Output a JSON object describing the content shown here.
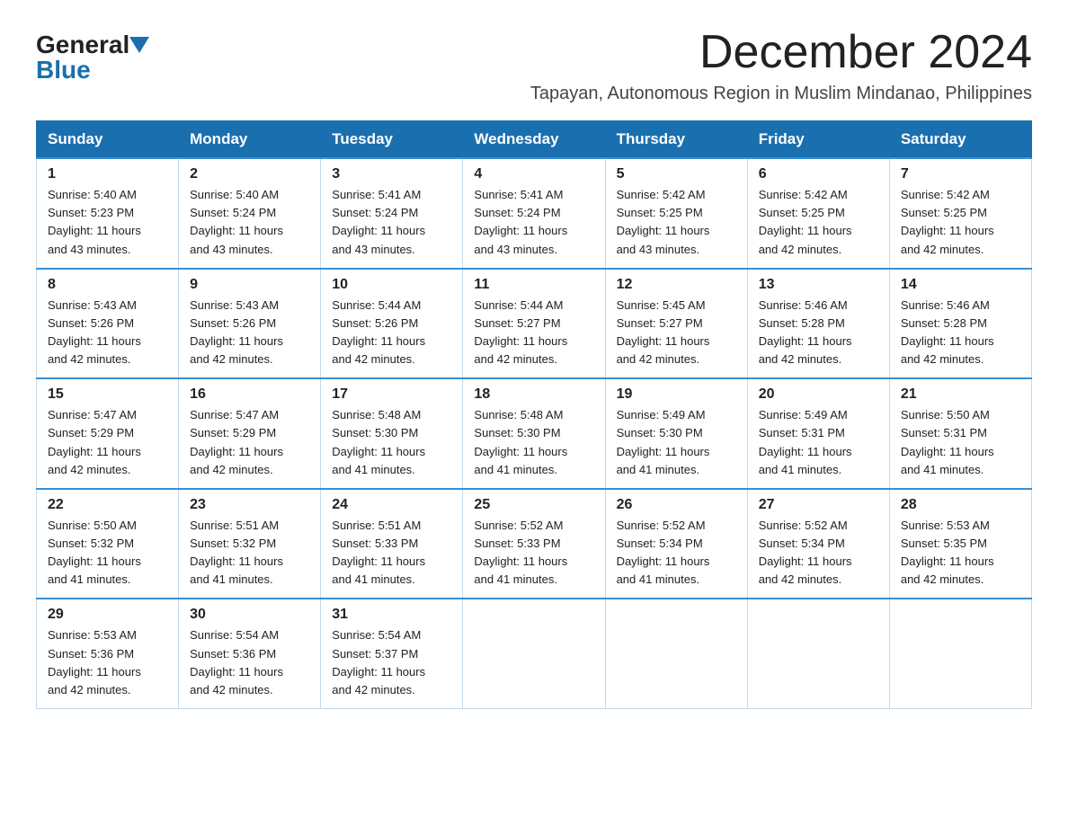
{
  "logo": {
    "general": "General",
    "blue": "Blue"
  },
  "title": "December 2024",
  "subtitle": "Tapayan, Autonomous Region in Muslim Mindanao, Philippines",
  "weekdays": [
    "Sunday",
    "Monday",
    "Tuesday",
    "Wednesday",
    "Thursday",
    "Friday",
    "Saturday"
  ],
  "weeks": [
    [
      {
        "day": "1",
        "sunrise": "5:40 AM",
        "sunset": "5:23 PM",
        "daylight": "11 hours and 43 minutes."
      },
      {
        "day": "2",
        "sunrise": "5:40 AM",
        "sunset": "5:24 PM",
        "daylight": "11 hours and 43 minutes."
      },
      {
        "day": "3",
        "sunrise": "5:41 AM",
        "sunset": "5:24 PM",
        "daylight": "11 hours and 43 minutes."
      },
      {
        "day": "4",
        "sunrise": "5:41 AM",
        "sunset": "5:24 PM",
        "daylight": "11 hours and 43 minutes."
      },
      {
        "day": "5",
        "sunrise": "5:42 AM",
        "sunset": "5:25 PM",
        "daylight": "11 hours and 43 minutes."
      },
      {
        "day": "6",
        "sunrise": "5:42 AM",
        "sunset": "5:25 PM",
        "daylight": "11 hours and 42 minutes."
      },
      {
        "day": "7",
        "sunrise": "5:42 AM",
        "sunset": "5:25 PM",
        "daylight": "11 hours and 42 minutes."
      }
    ],
    [
      {
        "day": "8",
        "sunrise": "5:43 AM",
        "sunset": "5:26 PM",
        "daylight": "11 hours and 42 minutes."
      },
      {
        "day": "9",
        "sunrise": "5:43 AM",
        "sunset": "5:26 PM",
        "daylight": "11 hours and 42 minutes."
      },
      {
        "day": "10",
        "sunrise": "5:44 AM",
        "sunset": "5:26 PM",
        "daylight": "11 hours and 42 minutes."
      },
      {
        "day": "11",
        "sunrise": "5:44 AM",
        "sunset": "5:27 PM",
        "daylight": "11 hours and 42 minutes."
      },
      {
        "day": "12",
        "sunrise": "5:45 AM",
        "sunset": "5:27 PM",
        "daylight": "11 hours and 42 minutes."
      },
      {
        "day": "13",
        "sunrise": "5:46 AM",
        "sunset": "5:28 PM",
        "daylight": "11 hours and 42 minutes."
      },
      {
        "day": "14",
        "sunrise": "5:46 AM",
        "sunset": "5:28 PM",
        "daylight": "11 hours and 42 minutes."
      }
    ],
    [
      {
        "day": "15",
        "sunrise": "5:47 AM",
        "sunset": "5:29 PM",
        "daylight": "11 hours and 42 minutes."
      },
      {
        "day": "16",
        "sunrise": "5:47 AM",
        "sunset": "5:29 PM",
        "daylight": "11 hours and 42 minutes."
      },
      {
        "day": "17",
        "sunrise": "5:48 AM",
        "sunset": "5:30 PM",
        "daylight": "11 hours and 41 minutes."
      },
      {
        "day": "18",
        "sunrise": "5:48 AM",
        "sunset": "5:30 PM",
        "daylight": "11 hours and 41 minutes."
      },
      {
        "day": "19",
        "sunrise": "5:49 AM",
        "sunset": "5:30 PM",
        "daylight": "11 hours and 41 minutes."
      },
      {
        "day": "20",
        "sunrise": "5:49 AM",
        "sunset": "5:31 PM",
        "daylight": "11 hours and 41 minutes."
      },
      {
        "day": "21",
        "sunrise": "5:50 AM",
        "sunset": "5:31 PM",
        "daylight": "11 hours and 41 minutes."
      }
    ],
    [
      {
        "day": "22",
        "sunrise": "5:50 AM",
        "sunset": "5:32 PM",
        "daylight": "11 hours and 41 minutes."
      },
      {
        "day": "23",
        "sunrise": "5:51 AM",
        "sunset": "5:32 PM",
        "daylight": "11 hours and 41 minutes."
      },
      {
        "day": "24",
        "sunrise": "5:51 AM",
        "sunset": "5:33 PM",
        "daylight": "11 hours and 41 minutes."
      },
      {
        "day": "25",
        "sunrise": "5:52 AM",
        "sunset": "5:33 PM",
        "daylight": "11 hours and 41 minutes."
      },
      {
        "day": "26",
        "sunrise": "5:52 AM",
        "sunset": "5:34 PM",
        "daylight": "11 hours and 41 minutes."
      },
      {
        "day": "27",
        "sunrise": "5:52 AM",
        "sunset": "5:34 PM",
        "daylight": "11 hours and 42 minutes."
      },
      {
        "day": "28",
        "sunrise": "5:53 AM",
        "sunset": "5:35 PM",
        "daylight": "11 hours and 42 minutes."
      }
    ],
    [
      {
        "day": "29",
        "sunrise": "5:53 AM",
        "sunset": "5:36 PM",
        "daylight": "11 hours and 42 minutes."
      },
      {
        "day": "30",
        "sunrise": "5:54 AM",
        "sunset": "5:36 PM",
        "daylight": "11 hours and 42 minutes."
      },
      {
        "day": "31",
        "sunrise": "5:54 AM",
        "sunset": "5:37 PM",
        "daylight": "11 hours and 42 minutes."
      },
      null,
      null,
      null,
      null
    ]
  ],
  "cell_labels": {
    "sunrise": "Sunrise:",
    "sunset": "Sunset:",
    "daylight": "Daylight:"
  }
}
